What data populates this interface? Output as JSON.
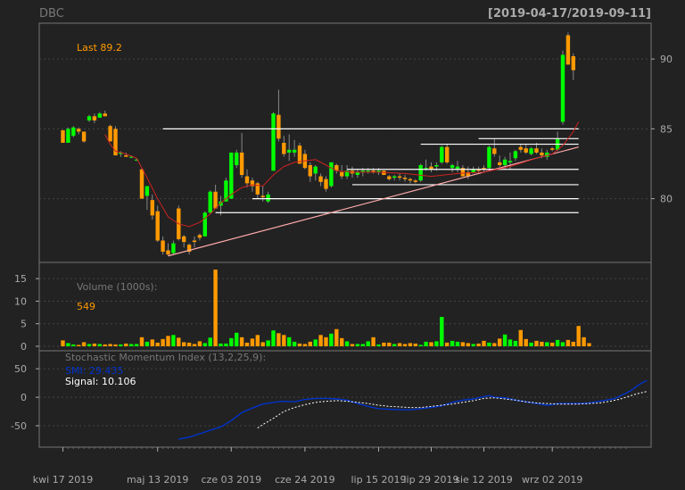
{
  "header": {
    "symbol": "DBC",
    "date_range": "[2019-04-17/2019-09-11]"
  },
  "colors": {
    "background": "#222222",
    "up": "#00ff00",
    "down": "#ff9900",
    "grid": "#444444",
    "text": "#aaaaaa",
    "sma": "#cc2222",
    "trendline": "#ffaaaa",
    "hlines": "#ffffff",
    "smi": "#0033cc",
    "signal": "#ffffff"
  },
  "chart_data": [
    {
      "type": "candlestick",
      "title": "DBC",
      "last_label": "Last 89.2",
      "y_ticks": [
        80,
        85,
        90
      ],
      "ylim": [
        75.5,
        92.5
      ],
      "x_tick_labels": [
        "kwi 17 2019",
        "maj 13 2019",
        "cze 03 2019",
        "cze 24 2019",
        "lip 15 2019",
        "lip 29 2019",
        "sie 12 2019",
        "wrz 02 2019"
      ],
      "x_tick_bars": [
        0,
        18,
        32,
        46,
        60,
        70,
        80,
        93
      ],
      "candles": [
        [
          84.9,
          84.9,
          84.0,
          84.0
        ],
        [
          84.0,
          85.1,
          84.0,
          85.0
        ],
        [
          84.5,
          85.2,
          84.4,
          85.1
        ],
        [
          85.0,
          85.1,
          84.6,
          84.8
        ],
        [
          84.8,
          84.8,
          84.0,
          84.1
        ],
        [
          85.6,
          86.0,
          85.5,
          85.9
        ],
        [
          85.9,
          86.1,
          85.4,
          85.6
        ],
        [
          85.8,
          86.2,
          85.8,
          86.1
        ],
        [
          86.1,
          86.3,
          85.9,
          85.9
        ],
        [
          85.2,
          85.3,
          84.1,
          84.1
        ],
        [
          85.0,
          85.2,
          83.1,
          83.1
        ],
        [
          83.2,
          83.4,
          83.0,
          83.3
        ],
        [
          83.1,
          83.3,
          83.0,
          83.0
        ],
        [
          83.0,
          83.1,
          82.9,
          83.0
        ],
        [
          82.8,
          82.9,
          82.7,
          82.8
        ],
        [
          82.1,
          82.2,
          80.0,
          80.0
        ],
        [
          80.2,
          80.9,
          79.2,
          80.9
        ],
        [
          79.9,
          80.3,
          78.5,
          78.8
        ],
        [
          79.1,
          79.5,
          76.9,
          77.0
        ],
        [
          77.0,
          77.3,
          76.0,
          76.2
        ],
        [
          76.3,
          76.8,
          75.9,
          76.0
        ],
        [
          76.1,
          77.0,
          76.0,
          76.8
        ],
        [
          79.3,
          79.5,
          77.0,
          77.1
        ],
        [
          77.3,
          77.4,
          76.5,
          76.9
        ],
        [
          76.7,
          76.8,
          76.0,
          76.2
        ],
        [
          77.0,
          77.3,
          76.5,
          76.9
        ],
        [
          77.4,
          77.5,
          77.0,
          77.2
        ],
        [
          77.3,
          79.1,
          77.3,
          79.0
        ],
        [
          79.0,
          80.6,
          78.9,
          80.5
        ],
        [
          80.5,
          81.0,
          79.3,
          79.3
        ],
        [
          79.5,
          80.2,
          78.8,
          79.8
        ],
        [
          79.8,
          81.5,
          79.8,
          81.3
        ],
        [
          80.0,
          83.3,
          80.0,
          83.3
        ],
        [
          82.4,
          83.5,
          82.2,
          83.3
        ],
        [
          83.3,
          84.7,
          81.5,
          81.7
        ],
        [
          81.6,
          82.1,
          80.8,
          81.1
        ],
        [
          81.3,
          81.5,
          80.5,
          80.9
        ],
        [
          81.1,
          81.2,
          80.0,
          80.3
        ],
        [
          80.2,
          80.9,
          79.8,
          80.1
        ],
        [
          79.8,
          80.5,
          79.7,
          80.3
        ],
        [
          82.0,
          86.2,
          82.0,
          86.1
        ],
        [
          86.0,
          87.8,
          84.1,
          84.3
        ],
        [
          84.0,
          84.5,
          83.0,
          83.2
        ],
        [
          83.3,
          84.6,
          82.7,
          83.5
        ],
        [
          83.3,
          84.2,
          83.0,
          83.5
        ],
        [
          83.8,
          84.0,
          82.5,
          82.5
        ],
        [
          83.2,
          83.5,
          82.1,
          82.2
        ],
        [
          82.4,
          82.6,
          81.2,
          81.6
        ],
        [
          81.8,
          82.4,
          81.3,
          82.3
        ],
        [
          81.6,
          81.8,
          80.9,
          81.2
        ],
        [
          81.4,
          81.6,
          80.5,
          80.7
        ],
        [
          80.9,
          82.6,
          80.8,
          82.6
        ],
        [
          82.4,
          82.5,
          81.8,
          82.0
        ],
        [
          81.9,
          82.4,
          81.4,
          81.6
        ],
        [
          81.6,
          82.4,
          81.4,
          82.0
        ],
        [
          82.0,
          82.3,
          81.5,
          81.8
        ],
        [
          81.7,
          82.1,
          81.5,
          81.9
        ],
        [
          81.9,
          82.2,
          81.6,
          82.0
        ],
        [
          82.0,
          82.2,
          81.8,
          82.0
        ],
        [
          82.0,
          82.2,
          81.8,
          81.9
        ],
        [
          81.9,
          82.2,
          81.7,
          82.0
        ],
        [
          82.0,
          82.0,
          81.7,
          81.7
        ],
        [
          81.6,
          81.7,
          81.3,
          81.4
        ],
        [
          81.5,
          81.7,
          81.3,
          81.6
        ],
        [
          81.6,
          81.8,
          81.3,
          81.5
        ],
        [
          81.5,
          81.7,
          81.2,
          81.4
        ],
        [
          81.4,
          81.5,
          81.1,
          81.3
        ],
        [
          81.3,
          81.4,
          81.1,
          81.2
        ],
        [
          81.3,
          82.5,
          81.2,
          82.4
        ],
        [
          82.2,
          82.8,
          82.0,
          82.2
        ],
        [
          82.3,
          82.6,
          81.9,
          82.1
        ],
        [
          82.3,
          82.6,
          82.0,
          82.4
        ],
        [
          82.6,
          83.8,
          82.5,
          83.7
        ],
        [
          83.7,
          83.9,
          82.5,
          82.6
        ],
        [
          82.2,
          82.5,
          81.9,
          82.4
        ],
        [
          82.1,
          82.7,
          81.9,
          82.3
        ],
        [
          82.2,
          82.4,
          81.6,
          81.6
        ],
        [
          81.9,
          82.3,
          81.4,
          81.6
        ],
        [
          81.9,
          82.3,
          81.8,
          82.1
        ],
        [
          82.1,
          82.3,
          81.9,
          82.0
        ],
        [
          82.2,
          82.4,
          81.9,
          82.1
        ],
        [
          82.2,
          83.8,
          82.0,
          83.7
        ],
        [
          83.6,
          84.3,
          83.0,
          83.2
        ],
        [
          82.6,
          83.1,
          82.3,
          82.4
        ],
        [
          82.4,
          83.0,
          82.1,
          82.8
        ],
        [
          82.6,
          83.3,
          82.1,
          82.7
        ],
        [
          82.9,
          83.5,
          82.7,
          83.4
        ],
        [
          83.7,
          83.9,
          83.3,
          83.5
        ],
        [
          83.6,
          83.9,
          83.2,
          83.3
        ],
        [
          83.2,
          83.7,
          83.1,
          83.6
        ],
        [
          83.6,
          84.0,
          83.2,
          83.3
        ],
        [
          83.3,
          83.6,
          82.9,
          83.1
        ],
        [
          83.0,
          83.5,
          82.8,
          83.3
        ],
        [
          83.6,
          83.7,
          83.4,
          83.5
        ],
        [
          83.5,
          84.8,
          83.4,
          84.3
        ],
        [
          85.5,
          90.6,
          85.3,
          90.3
        ],
        [
          91.7,
          91.9,
          89.6,
          89.6
        ],
        [
          90.2,
          90.4,
          88.5,
          89.2
        ]
      ],
      "sma": [
        [
          8,
          84.6
        ],
        [
          9,
          83.9
        ],
        [
          10,
          83.4
        ],
        [
          12,
          83.2
        ],
        [
          14,
          82.9
        ],
        [
          16,
          81.5
        ],
        [
          18,
          80.0
        ],
        [
          20,
          78.7
        ],
        [
          22,
          78.2
        ],
        [
          24,
          78.0
        ],
        [
          26,
          78.3
        ],
        [
          28,
          78.9
        ],
        [
          30,
          79.7
        ],
        [
          32,
          80.3
        ],
        [
          34,
          80.8
        ],
        [
          36,
          81.0
        ],
        [
          38,
          80.9
        ],
        [
          40,
          81.7
        ],
        [
          42,
          82.3
        ],
        [
          44,
          82.6
        ],
        [
          46,
          82.7
        ],
        [
          48,
          82.8
        ],
        [
          50,
          82.4
        ],
        [
          52,
          82.0
        ],
        [
          55,
          81.9
        ],
        [
          60,
          81.9
        ],
        [
          65,
          81.8
        ],
        [
          70,
          81.6
        ],
        [
          75,
          81.8
        ],
        [
          80,
          81.9
        ],
        [
          85,
          82.3
        ],
        [
          90,
          82.9
        ],
        [
          93,
          83.2
        ],
        [
          95,
          83.8
        ],
        [
          97,
          84.8
        ],
        [
          98,
          85.5
        ]
      ],
      "trendline": {
        "from": [
          20,
          75.9
        ],
        "to": [
          98,
          83.7
        ]
      },
      "hlines": [
        {
          "y": 85.0,
          "from": 19,
          "to": 98
        },
        {
          "y": 84.3,
          "from": 79,
          "to": 98
        },
        {
          "y": 83.9,
          "from": 68,
          "to": 98
        },
        {
          "y": 82.1,
          "from": 54,
          "to": 98
        },
        {
          "y": 81.0,
          "from": 55,
          "to": 98
        },
        {
          "y": 80.0,
          "from": 36,
          "to": 98
        },
        {
          "y": 79.0,
          "from": 29,
          "to": 98
        }
      ]
    },
    {
      "type": "bar",
      "title": "Volume (1000s):",
      "last_value": "549",
      "y_ticks": [
        0,
        5,
        10,
        15
      ],
      "ylim": [
        -0.8,
        18.4
      ],
      "values": [
        1.3,
        0.7,
        0.4,
        0.3,
        0.9,
        0.5,
        0.6,
        0.5,
        0.4,
        0.5,
        0.4,
        0.4,
        0.6,
        0.5,
        0.5,
        2.0,
        1.0,
        1.5,
        0.8,
        1.6,
        2.3,
        2.5,
        1.9,
        0.9,
        0.8,
        0.5,
        1.1,
        0.7,
        1.9,
        17.0,
        0.6,
        0.6,
        1.8,
        3.0,
        2.0,
        0.8,
        1.7,
        2.5,
        0.9,
        1.3,
        3.5,
        2.9,
        2.5,
        2.0,
        1.0,
        0.6,
        0.5,
        1.0,
        1.5,
        2.5,
        2.0,
        2.8,
        3.8,
        1.8,
        1.1,
        0.5,
        0.5,
        0.5,
        1.1,
        2.0,
        0.4,
        0.8,
        0.8,
        0.5,
        0.7,
        0.5,
        0.7,
        0.6,
        0.3,
        1.0,
        0.9,
        1.1,
        6.5,
        0.8,
        1.2,
        1.0,
        0.9,
        0.7,
        0.5,
        0.6,
        1.2,
        0.8,
        0.7,
        1.7,
        2.6,
        1.5,
        1.2,
        3.6,
        1.6,
        0.8,
        1.2,
        1.0,
        0.9,
        0.8,
        1.4,
        0.9,
        1.4,
        1.0,
        4.5,
        2.0,
        0.7
      ]
    },
    {
      "type": "line",
      "title": "Stochastic Momentum Index (13,2,25,9):",
      "smi_label": "SMI: 29.435",
      "signal_label": "Signal: 10.106",
      "y_ticks": [
        -50,
        0,
        50
      ],
      "ylim": [
        -86,
        80
      ],
      "series": [
        {
          "name": "SMI",
          "values": [
            [
              22,
              -73.5
            ],
            [
              24,
              -70
            ],
            [
              26,
              -64
            ],
            [
              28,
              -58
            ],
            [
              30,
              -52
            ],
            [
              32,
              -41
            ],
            [
              34,
              -27
            ],
            [
              36,
              -19
            ],
            [
              38,
              -12
            ],
            [
              40,
              -9
            ],
            [
              42,
              -7
            ],
            [
              44,
              -8
            ],
            [
              46,
              -4
            ],
            [
              48,
              -2
            ],
            [
              50,
              -2
            ],
            [
              52,
              -3
            ],
            [
              54,
              -5
            ],
            [
              56,
              -11
            ],
            [
              58,
              -16
            ],
            [
              60,
              -20
            ],
            [
              62,
              -21
            ],
            [
              64,
              -22
            ],
            [
              66,
              -22
            ],
            [
              68,
              -20
            ],
            [
              70,
              -18
            ],
            [
              72,
              -15
            ],
            [
              74,
              -9
            ],
            [
              76,
              -5
            ],
            [
              78,
              -3
            ],
            [
              80,
              1
            ],
            [
              81,
              3
            ],
            [
              82,
              0
            ],
            [
              84,
              -1
            ],
            [
              86,
              -5
            ],
            [
              88,
              -8
            ],
            [
              90,
              -11
            ],
            [
              92,
              -14
            ],
            [
              93,
              -13
            ],
            [
              94,
              -11
            ],
            [
              96,
              -11
            ],
            [
              98,
              -11
            ],
            [
              100,
              -10
            ],
            [
              102,
              -7
            ],
            [
              104,
              -4
            ],
            [
              105,
              -2
            ],
            [
              106,
              3
            ],
            [
              107,
              7
            ],
            [
              108,
              12
            ],
            [
              109,
              19
            ],
            [
              110,
              25
            ],
            [
              111,
              29.435
            ]
          ]
        },
        {
          "name": "Signal",
          "values": [
            [
              37,
              -54
            ],
            [
              38,
              -48
            ],
            [
              40,
              -37
            ],
            [
              42,
              -25
            ],
            [
              44,
              -18
            ],
            [
              46,
              -13
            ],
            [
              48,
              -9
            ],
            [
              50,
              -7
            ],
            [
              52,
              -6
            ],
            [
              54,
              -7
            ],
            [
              56,
              -9
            ],
            [
              58,
              -11
            ],
            [
              60,
              -14
            ],
            [
              62,
              -16
            ],
            [
              64,
              -17
            ],
            [
              66,
              -18
            ],
            [
              68,
              -18
            ],
            [
              70,
              -16
            ],
            [
              72,
              -14
            ],
            [
              74,
              -12
            ],
            [
              76,
              -9
            ],
            [
              78,
              -6
            ],
            [
              80,
              -2
            ],
            [
              82,
              -1
            ],
            [
              84,
              -3
            ],
            [
              86,
              -5
            ],
            [
              88,
              -8
            ],
            [
              90,
              -10
            ],
            [
              92,
              -11
            ],
            [
              94,
              -12
            ],
            [
              96,
              -12
            ],
            [
              98,
              -12
            ],
            [
              100,
              -11
            ],
            [
              102,
              -10
            ],
            [
              104,
              -7
            ],
            [
              106,
              -3
            ],
            [
              107,
              0
            ],
            [
              108,
              3
            ],
            [
              109,
              6
            ],
            [
              110,
              8
            ],
            [
              111,
              10.106
            ]
          ]
        }
      ]
    }
  ]
}
